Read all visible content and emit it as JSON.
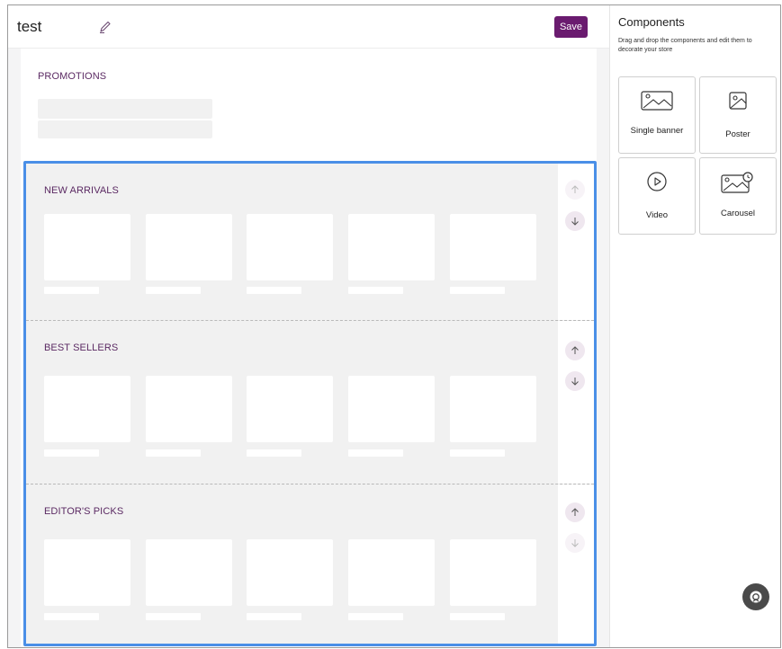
{
  "header": {
    "store_name": "test",
    "save_label": "Save"
  },
  "promotions": {
    "title": "PROMOTIONS"
  },
  "sections": [
    {
      "title": "NEW ARRIVALS"
    },
    {
      "title": "BEST SELLERS"
    },
    {
      "title": "EDITOR'S PICKS"
    }
  ],
  "panel": {
    "title": "Components",
    "description": "Drag and drop the components and edit them to decorate your store",
    "components": [
      {
        "label": "Single banner",
        "icon": "image-icon"
      },
      {
        "label": "Poster",
        "icon": "portrait-image-icon"
      },
      {
        "label": "Video",
        "icon": "play-icon"
      },
      {
        "label": "Carousel",
        "icon": "carousel-image-icon"
      }
    ]
  },
  "colors": {
    "accent": "#6a1b6f",
    "selection": "#4a8fe7",
    "section_title": "#5b2a63"
  },
  "icons": {
    "edit": "pencil-icon",
    "up": "arrow-up-icon",
    "down": "arrow-down-icon",
    "help": "help-fab-icon"
  }
}
